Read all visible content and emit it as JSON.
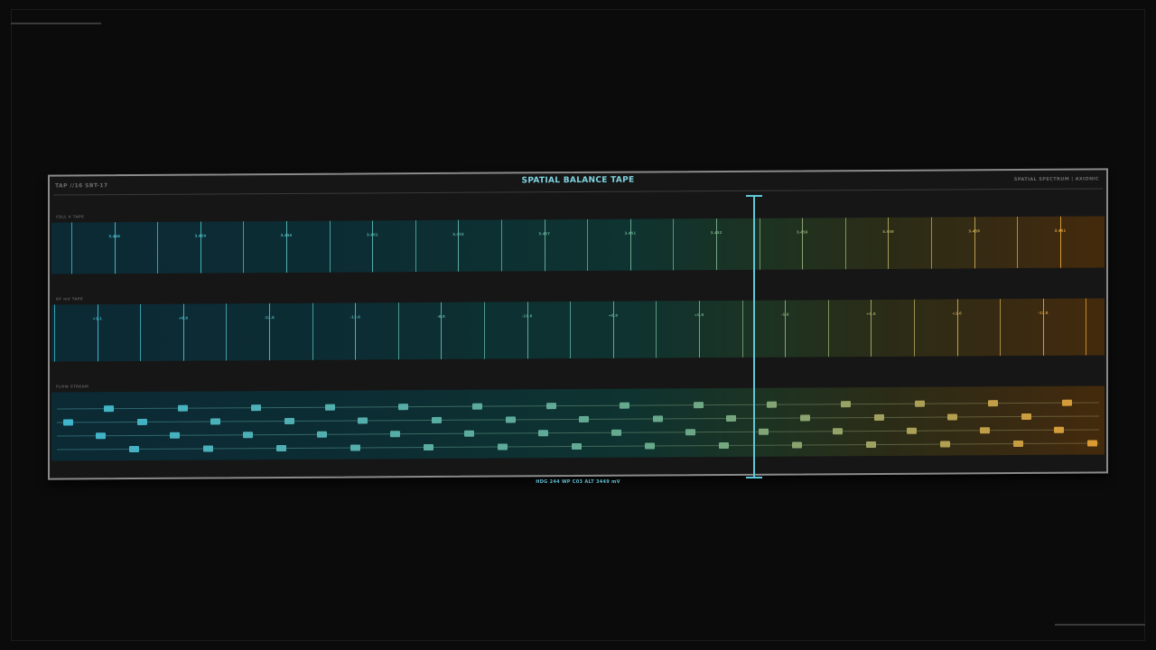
{
  "header": {
    "left": "TAP //16 SBT-17",
    "title": "SPATIAL BALANCE TAPE",
    "right": "SPATIAL SPECTRUM | AXIONIC"
  },
  "tapes": [
    {
      "label": "CELL V TAPE",
      "values": [
        "3.449",
        "3.454",
        "3.455",
        "3.461",
        "3.453",
        "3.457",
        "3.451",
        "3.452",
        "3.456",
        "3.450",
        "3.459",
        "3.461"
      ]
    },
    {
      "label": "KF mV TAPE",
      "values": [
        "+1.1",
        "+0.8",
        "-12.6",
        "-13.6",
        "-0.8",
        "-11.6",
        "+0.8",
        "+0.8",
        "-1.6",
        "+0.8",
        "+1.6",
        "-11.8"
      ]
    }
  ],
  "flow": {
    "label": "FLOW STREAM"
  },
  "readout": "HDG 244   WP C03   ALT 3449 mV",
  "colors": {
    "start": "#3fb4cc",
    "mid": "#6aa888",
    "end": "#e09a30"
  }
}
